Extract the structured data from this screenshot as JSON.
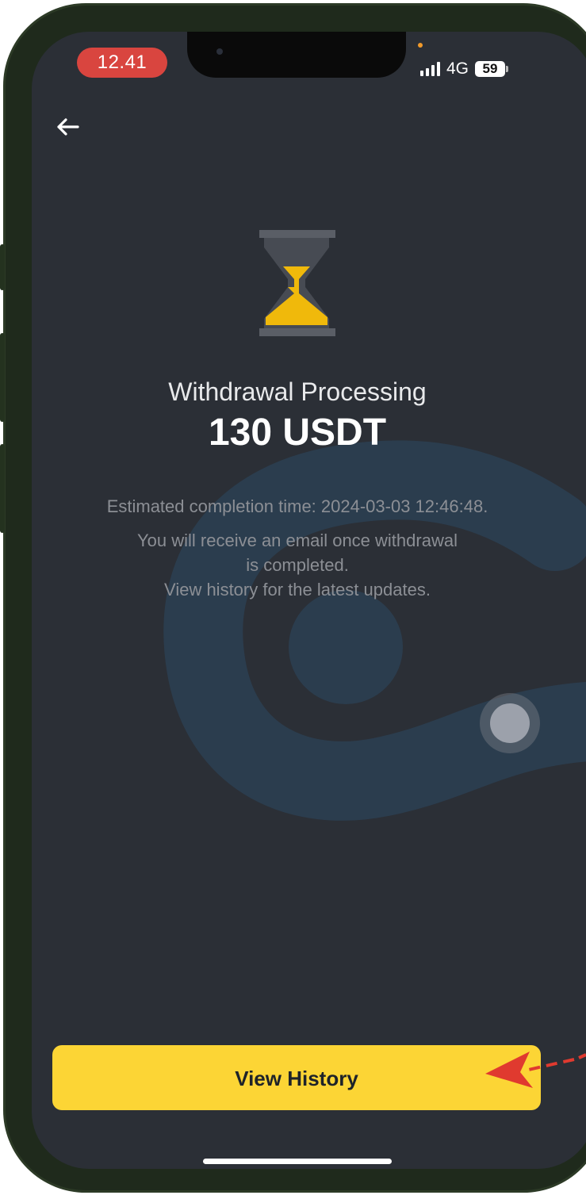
{
  "status_bar": {
    "time": "12.41",
    "network": "4G",
    "battery": "59"
  },
  "header": {
    "back_icon": "arrow-left-icon"
  },
  "status_icon": "hourglass-icon",
  "main": {
    "title": "Withdrawal Processing",
    "amount": "130 USDT",
    "estimated": "Estimated completion time: 2024-03-03 12:46:48.",
    "info_line_1": "You will receive an email once withdrawal",
    "info_line_2": "is completed.",
    "info_line_3": "View history for the latest updates."
  },
  "footer": {
    "view_history_label": "View History"
  },
  "colors": {
    "background": "#2b2f36",
    "accent": "#fcd535",
    "time_pill": "#d9453f",
    "annotation_arrow": "#e03a2f"
  }
}
